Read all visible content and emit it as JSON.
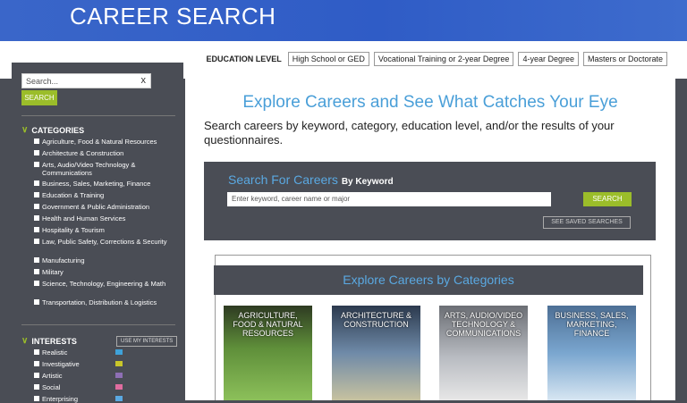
{
  "header": {
    "title": "CAREER SEARCH"
  },
  "education": {
    "label": "EDUCATION LEVEL",
    "options": [
      "High School or GED",
      "Vocational Training or 2-year Degree",
      "4-year Degree",
      "Masters or Doctorate"
    ]
  },
  "sidebar": {
    "search_placeholder": "Search...",
    "clear_icon": "x",
    "search_button": "SEARCH",
    "categories_heading": "CATEGORIES",
    "categories": [
      "Agriculture, Food & Natural Resources",
      "Architecture & Construction",
      "Arts, Audio/Video Technology & Communications",
      "Business, Sales, Marketing, Finance",
      "Education & Training",
      "Government & Public Administration",
      "Health and Human Services",
      "Hospitality & Tourism",
      "Law, Public Safety, Corrections & Security",
      "Manufacturing",
      "Military",
      "Science, Technology, Engineering & Math",
      "Transportation, Distribution & Logistics"
    ],
    "interests_heading": "INTERESTS",
    "use_interests_button": "USE MY INTERESTS",
    "interests": [
      {
        "label": "Realistic",
        "color": "#3fa2d9"
      },
      {
        "label": "Investigative",
        "color": "#c9c62a"
      },
      {
        "label": "Artistic",
        "color": "#8e6fb5"
      },
      {
        "label": "Social",
        "color": "#e06c9f"
      },
      {
        "label": "Enterprising",
        "color": "#5aa9e2"
      }
    ]
  },
  "main": {
    "title": "Explore Careers and See What Catches Your Eye",
    "description": "Search careers by keyword, category, education level, and/or the results of your questionnaires.",
    "keyword": {
      "title": "Search For Careers",
      "subtitle": "By Keyword",
      "placeholder": "Enter keyword, career name or major",
      "button": "SEARCH",
      "saved_button": "SEE SAVED SEARCHES"
    },
    "categories_title": "Explore Careers by Categories",
    "tiles": [
      {
        "label": "AGRICULTURE, FOOD & NATURAL RESOURCES",
        "bg": "#5f8f3a"
      },
      {
        "label": "ARCHITECTURE & CONSTRUCTION",
        "bg": "#6f8aa8"
      },
      {
        "label": "ARTS, AUDIO/VIDEO TECHNOLOGY & COMMUNICATIONS",
        "bg": "#b9bcc2"
      },
      {
        "label": "BUSINESS, SALES, MARKETING, FINANCE",
        "bg": "#7aa6cf"
      }
    ]
  }
}
